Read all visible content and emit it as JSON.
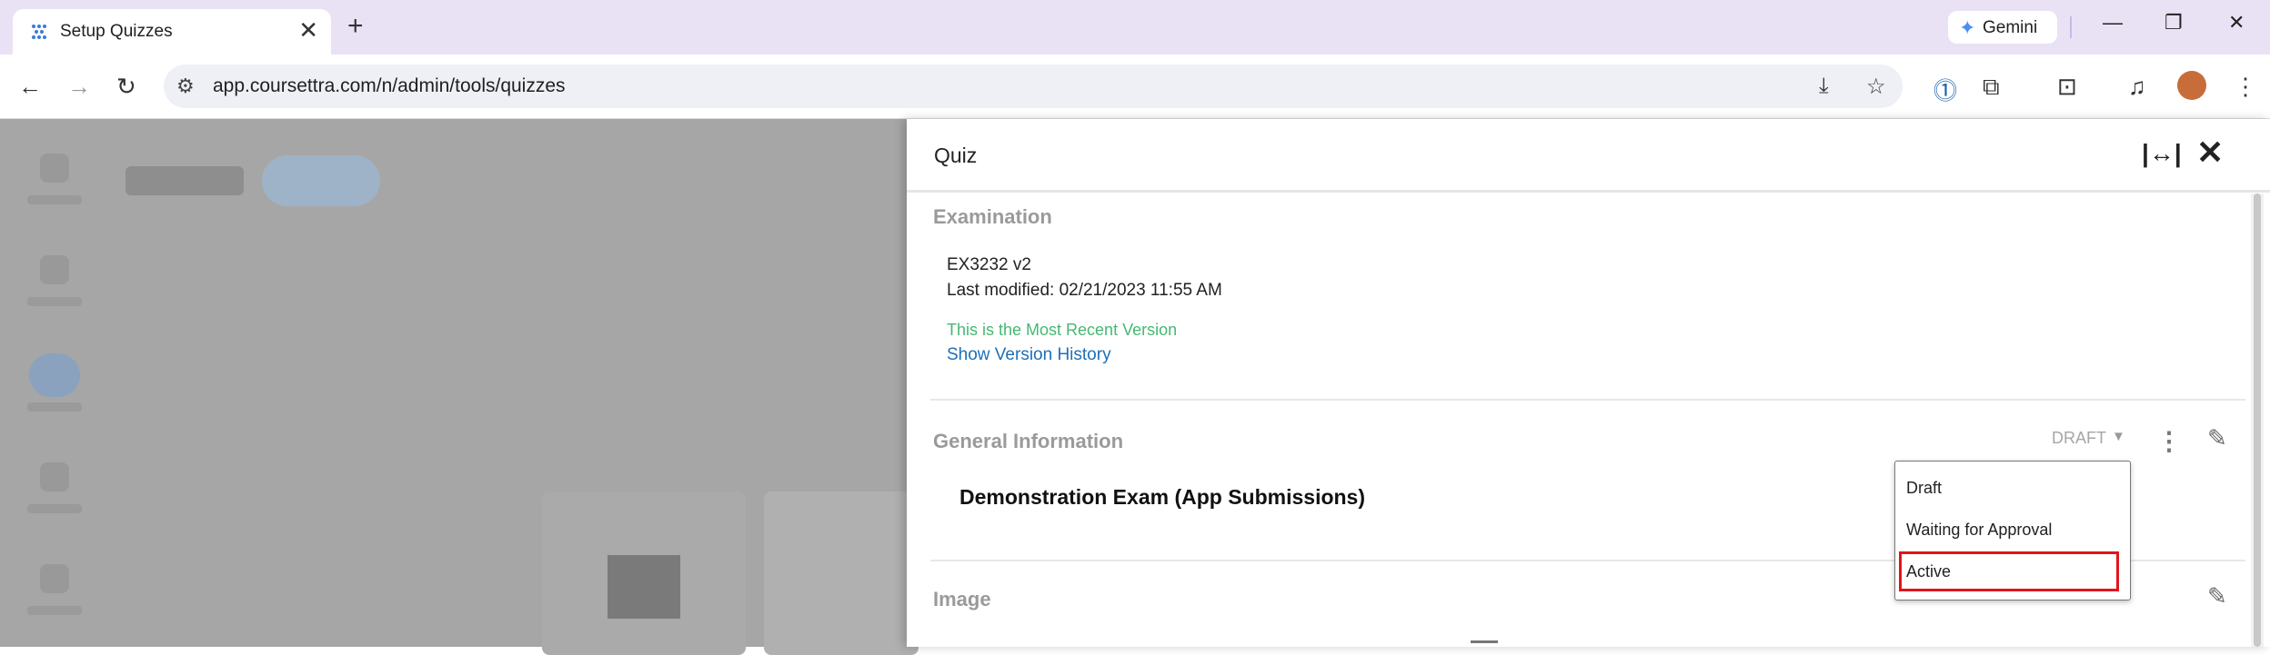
{
  "browser": {
    "tab_title": "Setup Quizzes",
    "tab_close": "✕",
    "new_tab": "+",
    "gemini_label": "Gemini",
    "url": "app.coursettra.com/n/admin/tools/quizzes",
    "accent": "#e9e2f4"
  },
  "drawer": {
    "title": "Quiz",
    "expand_icon": "|↔|",
    "close_icon": "✕",
    "examination": {
      "section_title": "Examination",
      "code": "EX3232  v2",
      "last_modified": "Last modified: 02/21/2023 11:55 AM",
      "recent_note": "This is the Most Recent Version",
      "history_link": "Show Version History"
    },
    "general": {
      "section_title": "General Information",
      "status_value": "DRAFT",
      "exam_name": "Demonstration Exam (App Submissions)"
    },
    "image": {
      "section_title": "Image"
    }
  },
  "status_menu": {
    "options": [
      "Draft",
      "Waiting for Approval",
      "Active"
    ],
    "highlighted": "Active",
    "highlight_color": "#e0141c"
  }
}
